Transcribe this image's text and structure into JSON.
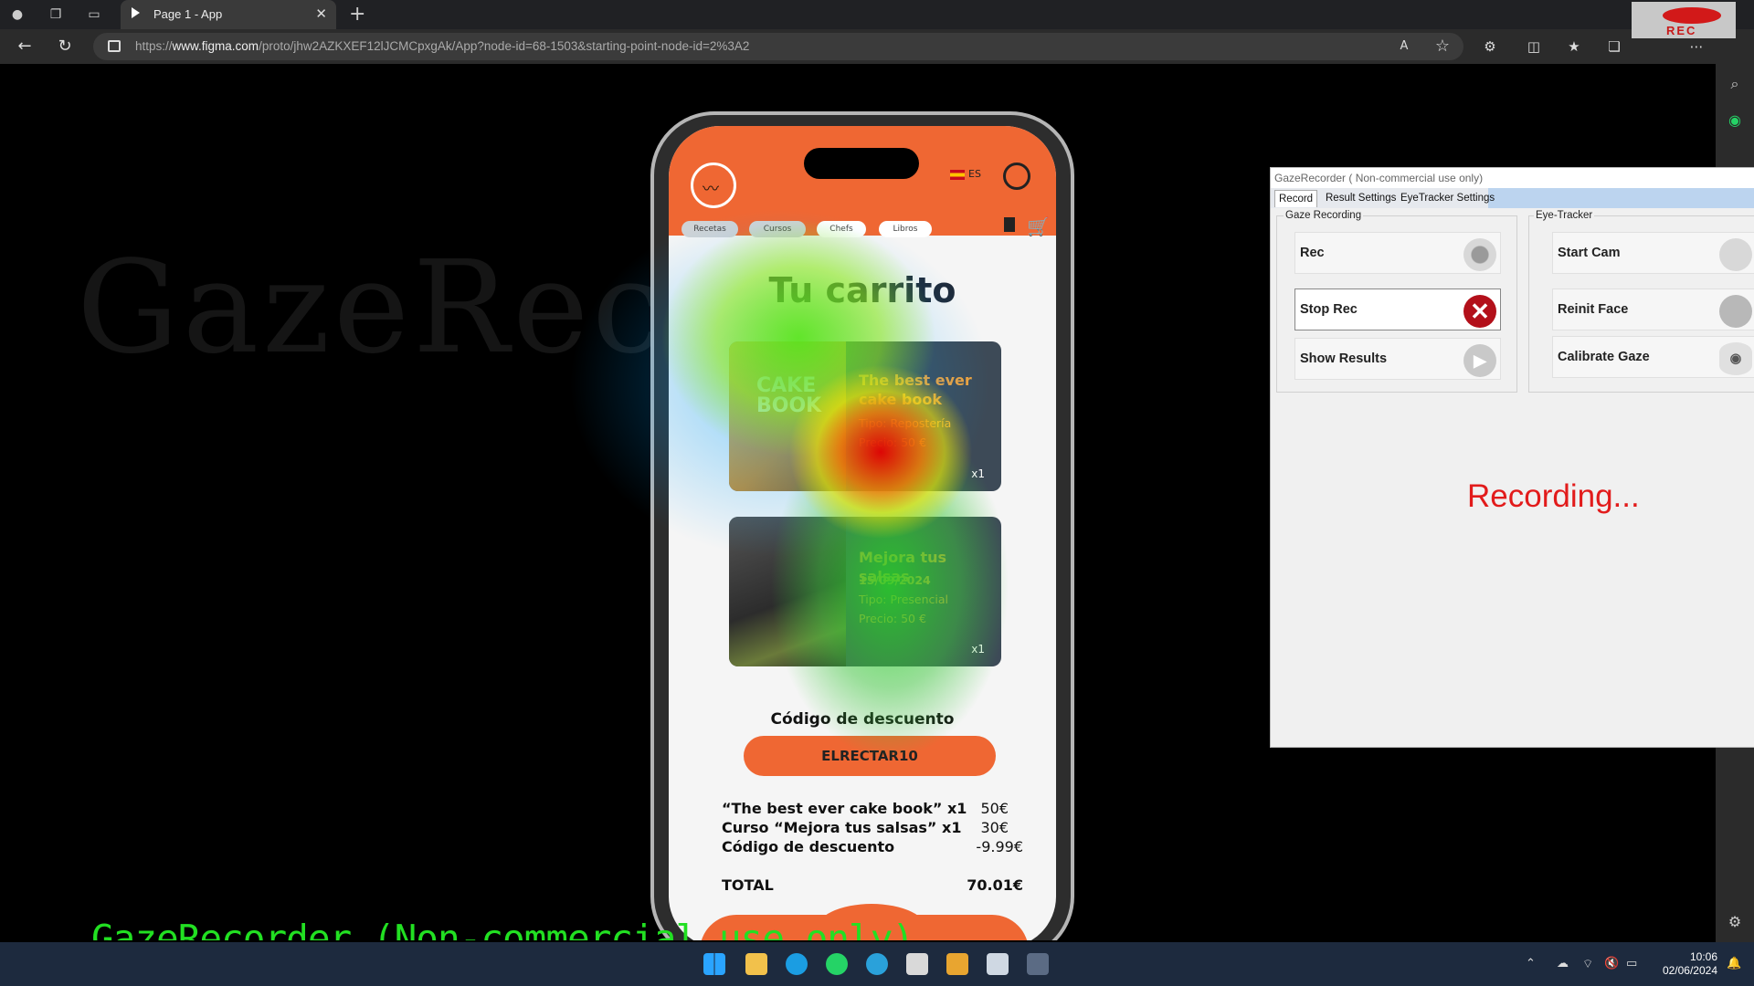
{
  "browser": {
    "tab_title": "Page 1 - App",
    "url_domain": "www.figma.com",
    "url_prefix": "https://",
    "url_path": "/proto/jhw2AZKXEF12lJCMCpxgAk/App?node-id=68-1503&starting-point-node-id=2%3A2",
    "rec_badge": "REC"
  },
  "watermark": "GazeRecorder",
  "app": {
    "lang": "ES",
    "chips": [
      "Recetas",
      "Cursos",
      "Chefs",
      "Libros"
    ],
    "title": "Tu carrito",
    "items": [
      {
        "title_line1": "The best ever",
        "title_line2": "cake book",
        "tipo_label": "Tipo:",
        "tipo": "Repostería",
        "precio_label": "Precio:",
        "precio": "50 €",
        "qty": "x1",
        "book_text": "CAKE BOOK"
      },
      {
        "title_line1": "Mejora tus salsas",
        "date": "15/09/2024",
        "tipo_label": "Tipo:",
        "tipo": "Presencial",
        "precio_label": "Precio:",
        "precio": "50 €",
        "qty": "x1"
      }
    ],
    "discount_label": "Código de descuento",
    "discount_code": "ELRECTAR10",
    "summary": [
      {
        "label": "“The best ever cake book”  x1",
        "value": "50€"
      },
      {
        "label": "Curso “Mejora tus salsas”  x1",
        "value": "30€"
      },
      {
        "label": "Código de descuento",
        "value": "-9.99€"
      }
    ],
    "total_label": "TOTAL",
    "total_value": "70.01€"
  },
  "gaze_recorder": {
    "title": "GazeRecorder   ( Non-commercial use only)",
    "tabs": [
      "Record",
      "Result Settings",
      "EyeTracker Settings"
    ],
    "group_gaze": "Gaze Recording",
    "group_eye": "Eye-Tracker",
    "buttons_left": [
      "Rec",
      "Stop Rec",
      "Show Results"
    ],
    "buttons_right": [
      "Start Cam",
      "Reinit Face",
      "Calibrate Gaze"
    ],
    "status": "Recording..."
  },
  "overlay_text": "GazeRecorder (Non-commercial use only)",
  "taskbar": {
    "time": "10:06",
    "date": "02/06/2024"
  },
  "colors": {
    "brand_orange": "#ef6733",
    "recording_red": "#e21b1b",
    "overlay_green": "#22e022"
  }
}
